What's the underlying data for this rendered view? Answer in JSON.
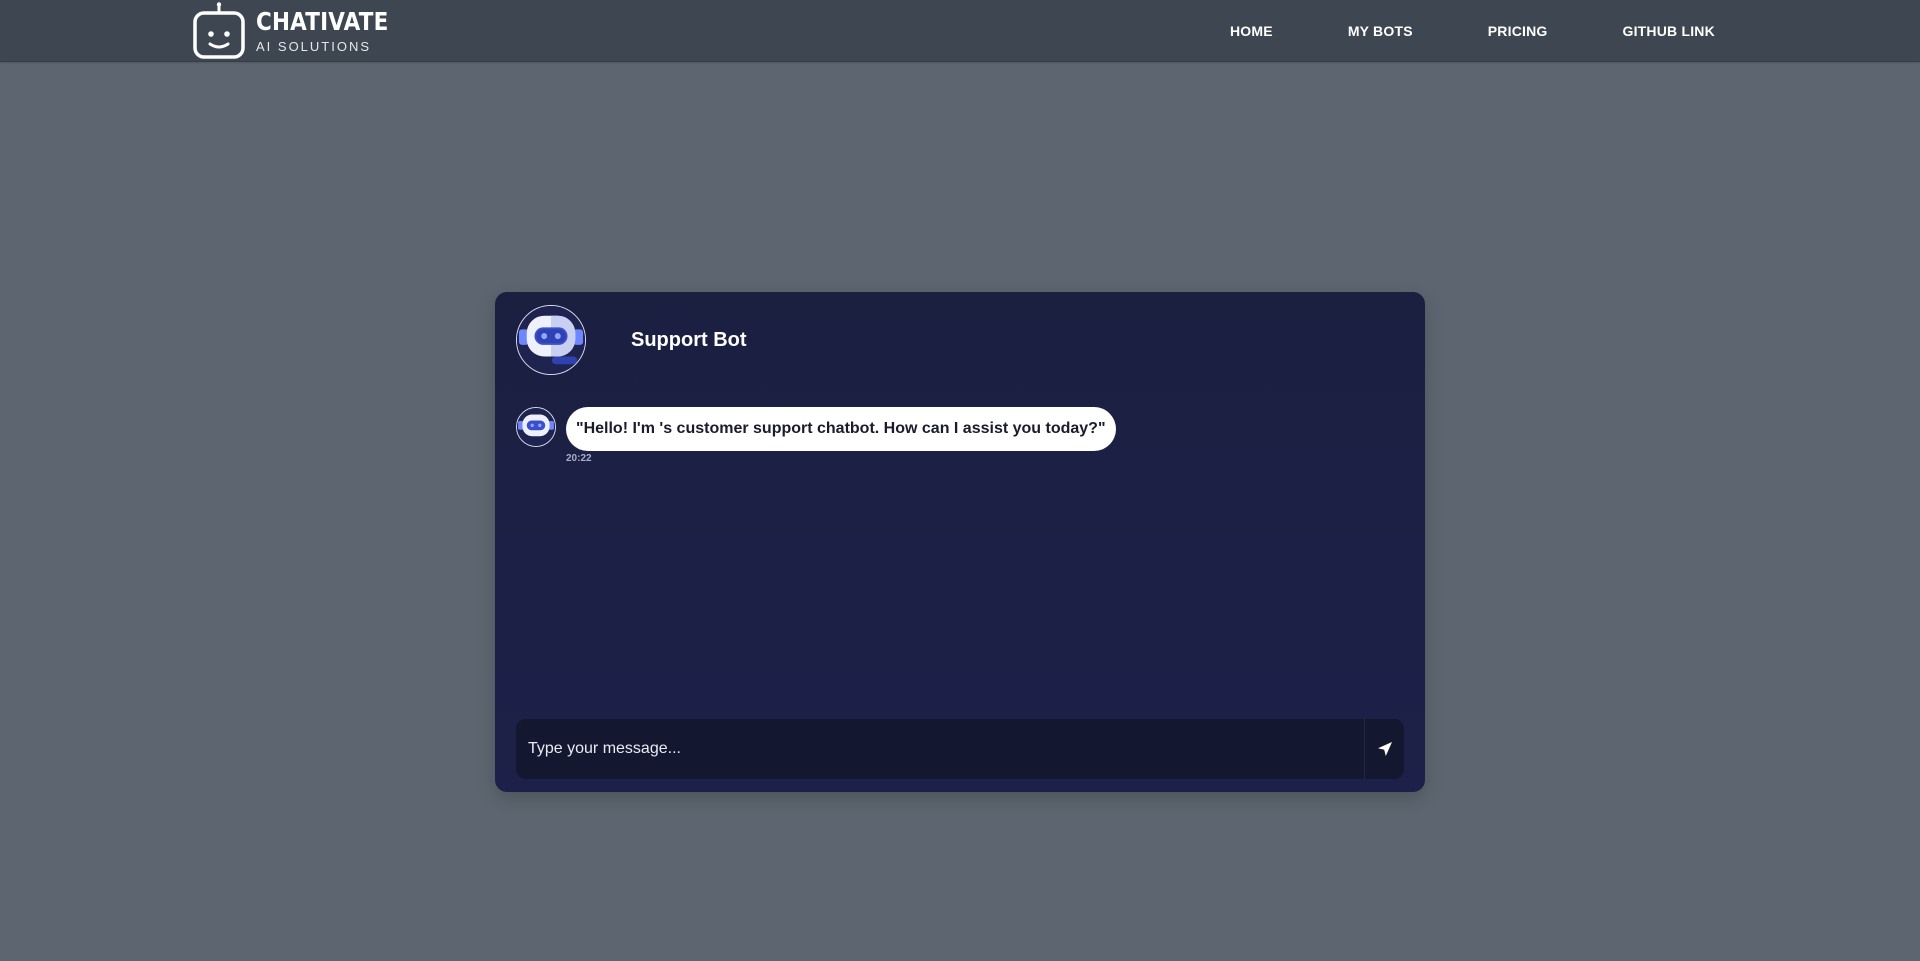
{
  "brand": {
    "title": "CHATIVATE",
    "subtitle": "AI SOLUTIONS",
    "icon": "robot-face-logo-icon"
  },
  "nav": {
    "links": [
      {
        "label": "HOME"
      },
      {
        "label": "MY BOTS"
      },
      {
        "label": "PRICING"
      },
      {
        "label": "GITHUB LINK"
      }
    ]
  },
  "chat": {
    "bot_name": "Support Bot",
    "avatar_icon": "robot-avatar-icon",
    "messages": [
      {
        "sender": "bot",
        "text": "\"Hello! I'm 's customer support chatbot. How can I assist you today?\"",
        "time": "20:22"
      }
    ],
    "input": {
      "placeholder": "Type your message...",
      "value": ""
    },
    "send_icon": "paper-plane-send-icon"
  },
  "colors": {
    "page_bg": "#5d6670",
    "navbar_bg": "#3e4651",
    "card_bg": "#1c2046",
    "input_bg": "#131730",
    "bubble_bg": "#ffffff",
    "accent": "#4a63d8"
  }
}
